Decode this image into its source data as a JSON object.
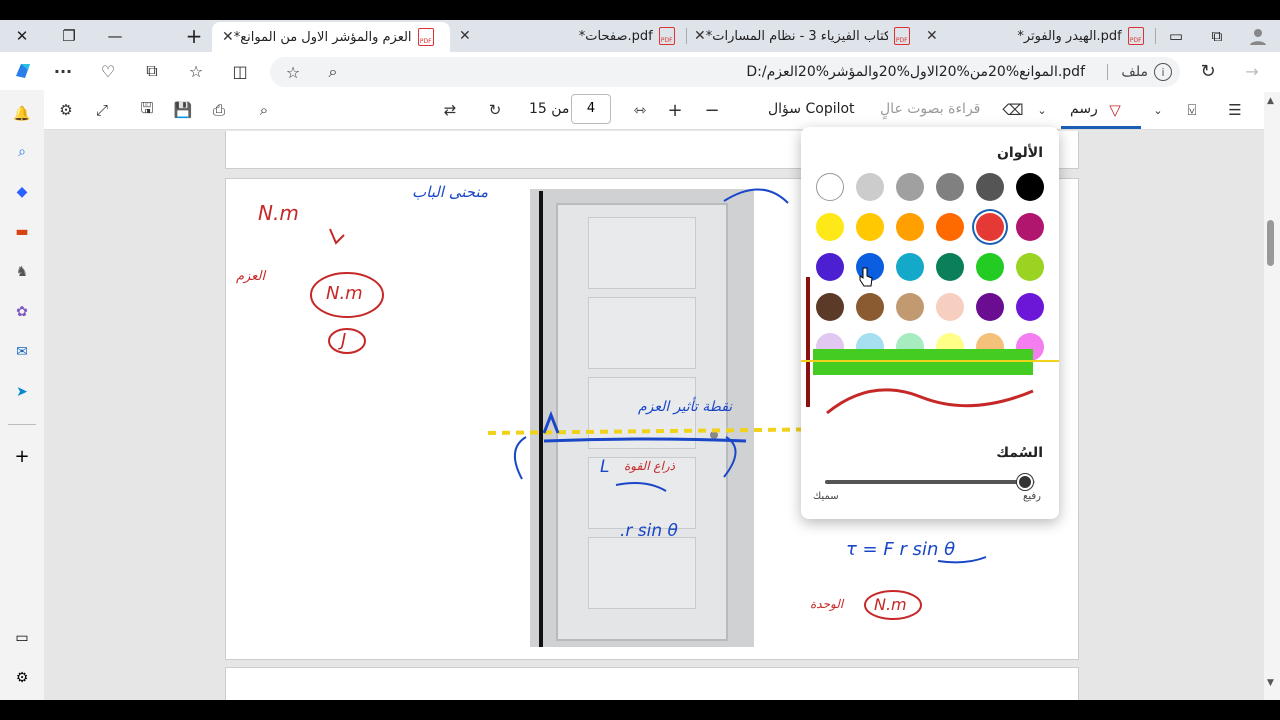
{
  "tabs": [
    {
      "label": "*العزم والمؤشر الاول من الموانع.pdf",
      "active": true
    },
    {
      "label": "*صفحات.pdf",
      "active": false
    },
    {
      "label": "*كتاب الفيزياء 3 - نظام المسارات.pdf",
      "active": false
    },
    {
      "label": "*الهيدر والفوتر.pdf",
      "active": false
    }
  ],
  "address": {
    "url": "D:/الموانع%20من%20الاول%20والمؤشر%20العزم.pdf",
    "file_label": "ملف"
  },
  "pdf_toolbar": {
    "draw_label": "رسم",
    "read_aloud_label": "قراءة بصوت عالٍ",
    "copilot_label": "سؤال Copilot",
    "page_current": "4",
    "page_total": "من 15"
  },
  "color_panel": {
    "title": "الألوان",
    "thickness_title": "السُمك",
    "thin_label": "رفيع",
    "thick_label": "سميك",
    "thickness_level": 0.95,
    "selected_color": "#e53935",
    "swatches": [
      [
        "#000000",
        "#555555",
        "#808080",
        "#a0a0a0",
        "#cccccc",
        "#ffffff"
      ],
      [
        "#b0166e",
        "#e53935",
        "#ff6a00",
        "#ffa000",
        "#ffc800",
        "#ffe817"
      ],
      [
        "#9ad322",
        "#22cc22",
        "#0b7f5a",
        "#14a9c8",
        "#0b5ee0",
        "#4c1fd1"
      ],
      [
        "#6c17d8",
        "#6a0d91",
        "#f6cfc0",
        "#c29a72",
        "#8a5a30",
        "#5c3a28"
      ],
      [
        "#f47ef0",
        "#f5c07a",
        "#ffff88",
        "#a6ecc0",
        "#a6dff0",
        "#e0c8f0"
      ]
    ]
  },
  "annotations": {
    "nm_top": "N.m",
    "torque_label": "العزم",
    "nm_circle": "N.m",
    "j_circle": "J",
    "hinge_label": "منحنى الباب",
    "torque_effect": "نقطة تأثير العزم",
    "L_label": "L",
    "arm_label": "ذراع القوة",
    "rsin": ".r sin θ",
    "formula": "τ = F r  sin θ",
    "unit_nm": "N.m",
    "unit_label": "الوحدة"
  }
}
